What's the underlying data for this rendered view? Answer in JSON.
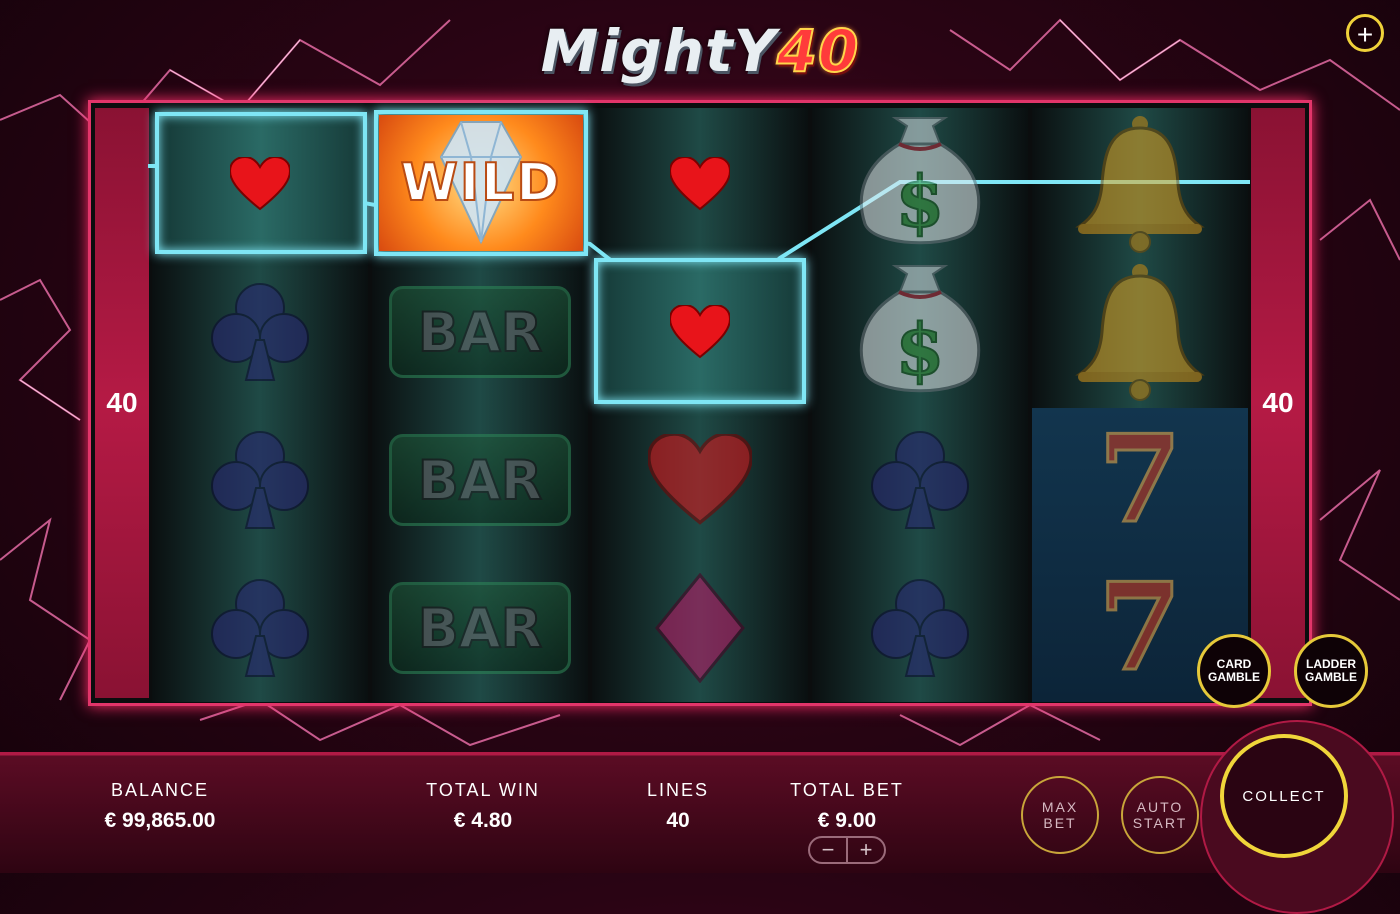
{
  "game": {
    "logo_word": "MightY",
    "logo_number": "40",
    "menu_icon": "plus-icon"
  },
  "reels": {
    "lines_left": "40",
    "lines_right": "40",
    "columns": [
      [
        "heart",
        "club",
        "club",
        "club"
      ],
      [
        "wild",
        "bar",
        "bar",
        "bar"
      ],
      [
        "heart",
        "heart",
        "heart",
        "diamond"
      ],
      [
        "money-bag",
        "money-bag",
        "club",
        "club"
      ],
      [
        "bell",
        "bell",
        "seven",
        "seven"
      ]
    ],
    "wild_label": "WILD",
    "bar_label": "BAR",
    "seven_label": "7"
  },
  "gamble": {
    "card_line1": "CARD",
    "card_line2": "GAMBLE",
    "ladder_line1": "LADDER",
    "ladder_line2": "GAMBLE"
  },
  "footer": {
    "balance_label": "BALANCE",
    "balance_value": "€ 99,865.00",
    "total_win_label": "TOTAL WIN",
    "total_win_value": "€ 4.80",
    "lines_label": "LINES",
    "lines_value": "40",
    "total_bet_label": "TOTAL BET",
    "total_bet_value": "€ 9.00",
    "bet_minus": "−",
    "bet_plus": "+",
    "max_bet_line1": "MAX",
    "max_bet_line2": "BET",
    "auto_start_line1": "AUTO",
    "auto_start_line2": "START",
    "collect_label": "COLLECT"
  },
  "colors": {
    "frame": "#e2356a",
    "win_highlight": "#7fe6f5",
    "gold": "#f0d63a"
  }
}
